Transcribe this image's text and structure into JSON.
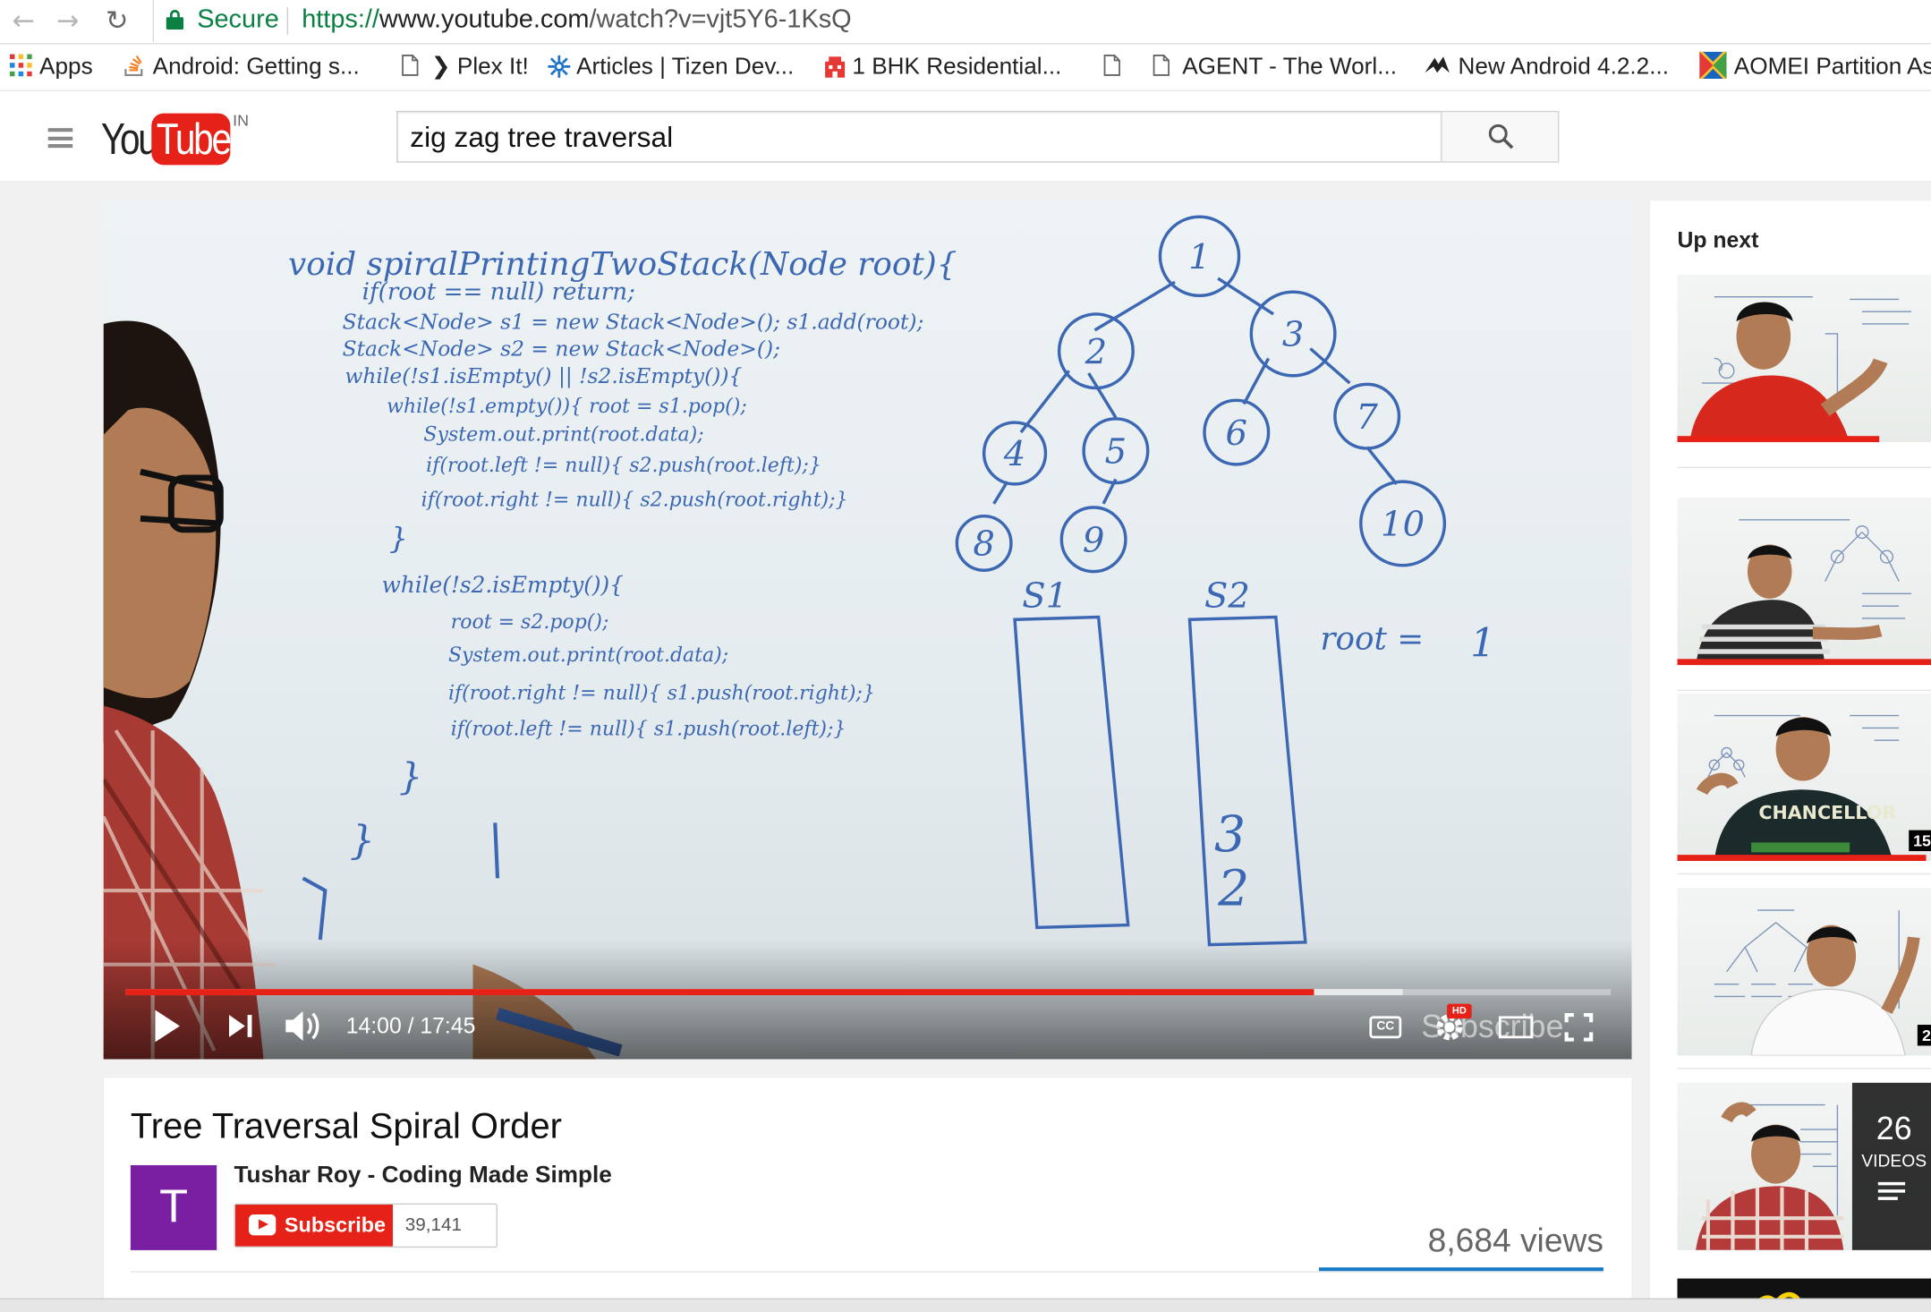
{
  "browser": {
    "secure_label": "Secure",
    "url_scheme": "https://",
    "url_host": "www.youtube.com",
    "url_path": "/watch?v=vjt5Y6-1KsQ",
    "bookmarks": [
      {
        "label": "Apps"
      },
      {
        "label": "Android: Getting s..."
      },
      {
        "label": "❯ Plex It!"
      },
      {
        "label": "Articles | Tizen Dev..."
      },
      {
        "label": "1 BHK Residential..."
      },
      {
        "label": ""
      },
      {
        "label": "AGENT - The Worl..."
      },
      {
        "label": "New Android 4.2.2..."
      },
      {
        "label": "AOMEI Partition As"
      }
    ]
  },
  "header": {
    "logo_you": "You",
    "logo_tube": "Tube",
    "logo_region": "IN",
    "search_value": "zig zag tree traversal"
  },
  "player": {
    "time_display": "14:00 / 17:45",
    "progress_fraction": 0.8,
    "buffer_fraction": 0.86,
    "cc_label": "CC",
    "hd_label": "HD",
    "subscribe_overlay": "Subscribe",
    "whiteboard": {
      "code_lines": [
        "void spiralPrintingTwoStack(Node root){",
        "if(root == null) return;",
        "Stack<Node> s1 = new Stack<Node>(); s1.add(root);",
        "Stack<Node> s2 = new Stack<Node>();",
        "while(!s1.isEmpty() || !s2.isEmpty()){",
        "while(!s1.empty()){ root = s1.pop();",
        "System.out.print(root.data);",
        "if(root.left != null){ s2.push(root.left);}",
        "if(root.right != null){ s2.push(root.right);}",
        "}",
        "while(!s2.isEmpty()){",
        "root = s2.pop();",
        "System.out.print(root.data);",
        "if(root.right != null){ s1.push(root.right);}",
        "if(root.left != null){ s1.push(root.left);}",
        "}",
        "}"
      ],
      "tree_nodes": [
        "1",
        "2",
        "3",
        "4",
        "5",
        "6",
        "7",
        "8",
        "9",
        "10"
      ],
      "stack1_label": "S1",
      "stack2_label": "S2",
      "stack2_items": [
        "3",
        "2"
      ],
      "root_label": "root =",
      "root_value": "1"
    }
  },
  "video": {
    "title": "Tree Traversal Spiral Order",
    "channel_initial": "T",
    "channel_name": "Tushar Roy - Coding Made Simple",
    "subscribe_label": "Subscribe",
    "subscriber_count": "39,141",
    "views": "8,684 views",
    "like_fraction": 1.0
  },
  "sidebar": {
    "heading": "Up next",
    "items": [
      {
        "duration": "",
        "watched_fraction": 0.78,
        "shirt_color": "#d7281e"
      },
      {
        "duration": "",
        "watched_fraction": 1.0,
        "shirt_color": "#333"
      },
      {
        "duration": "15",
        "watched_fraction": 0.96,
        "shirt_color": "#1b2a2a",
        "shirt_text": "CHANCELLOR"
      },
      {
        "duration": "2",
        "watched_fraction": 0,
        "shirt_color": "#fff"
      },
      {
        "duration": "",
        "watched_fraction": 0,
        "shirt_color": "#b53a3a",
        "playlist_count": "26",
        "playlist_label": "VIDEOS"
      }
    ]
  },
  "colors": {
    "brand_red": "#e62117",
    "secure_green": "#0b8043",
    "marker_blue": "#3c67b3",
    "avatar_purple": "#7b1fa2"
  }
}
